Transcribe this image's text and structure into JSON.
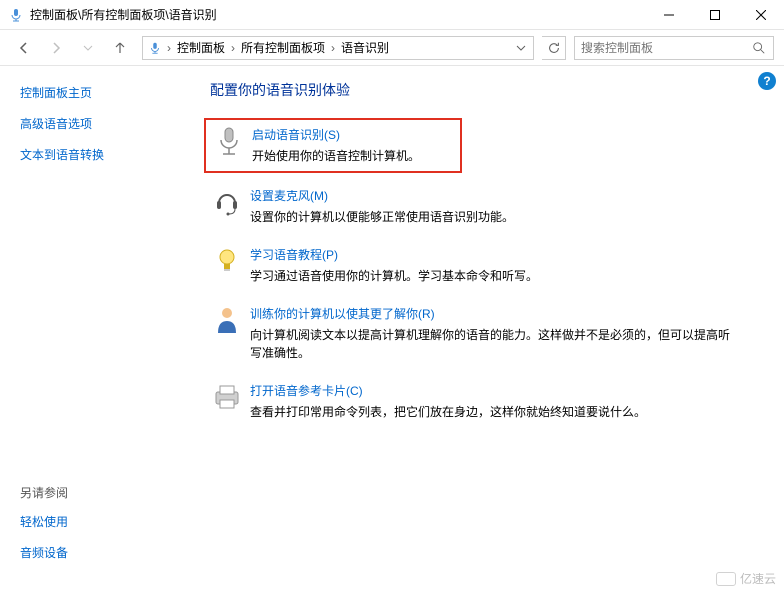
{
  "window": {
    "title": "控制面板\\所有控制面板项\\语音识别"
  },
  "breadcrumb": {
    "items": [
      "控制面板",
      "所有控制面板项",
      "语音识别"
    ]
  },
  "search": {
    "placeholder": "搜索控制面板"
  },
  "sidebar": {
    "home": "控制面板主页",
    "links": [
      "高级语音选项",
      "文本到语音转换"
    ],
    "seealso_title": "另请参阅",
    "seealso": [
      "轻松使用",
      "音频设备"
    ]
  },
  "main": {
    "heading": "配置你的语音识别体验",
    "items": [
      {
        "icon": "microphone-icon",
        "link": "启动语音识别(S)",
        "desc": "开始使用你的语音控制计算机。",
        "highlighted": true
      },
      {
        "icon": "headset-icon",
        "link": "设置麦克风(M)",
        "desc": "设置你的计算机以便能够正常使用语音识别功能。"
      },
      {
        "icon": "lightbulb-icon",
        "link": "学习语音教程(P)",
        "desc": "学习通过语音使用你的计算机。学习基本命令和听写。"
      },
      {
        "icon": "person-icon",
        "link": "训练你的计算机以使其更了解你(R)",
        "desc": "向计算机阅读文本以提高计算机理解你的语音的能力。这样做并不是必须的，但可以提高听写准确性。"
      },
      {
        "icon": "printer-icon",
        "link": "打开语音参考卡片(C)",
        "desc": "查看并打印常用命令列表，把它们放在身边，这样你就始终知道要说什么。"
      }
    ]
  },
  "watermark": "亿速云"
}
